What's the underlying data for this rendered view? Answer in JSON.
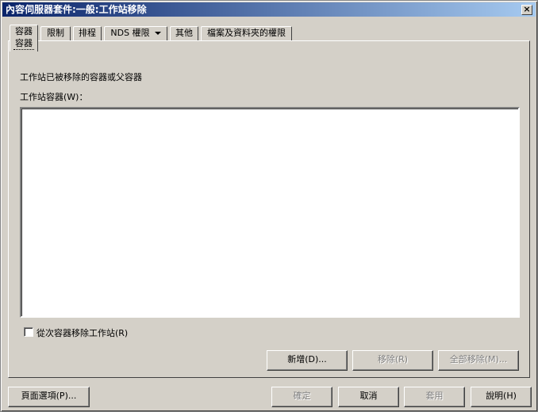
{
  "window": {
    "title": "內容伺服器套件:一般:工作站移除",
    "close_glyph": "×"
  },
  "tabs": [
    {
      "label": "容器",
      "sublabel": "容器",
      "active": true
    },
    {
      "label": "限制"
    },
    {
      "label": "排程"
    },
    {
      "label": "NDS 權限"
    },
    {
      "label": "其他"
    },
    {
      "label": "檔案及資料夾的權限"
    }
  ],
  "main": {
    "description": "工作站已被移除的容器或父容器",
    "list_label": "工作站容器(W)：",
    "checkbox_label": "從次容器移除工作站(R)",
    "checkbox_checked": false
  },
  "buttons": {
    "add": "新增(D)...",
    "remove": "移除(R)",
    "remove_all": "全部移除(M)..."
  },
  "footer": {
    "page_options": "頁面選項(P)...",
    "ok": "確定",
    "cancel": "取消",
    "apply": "套用",
    "help": "說明(H)"
  }
}
